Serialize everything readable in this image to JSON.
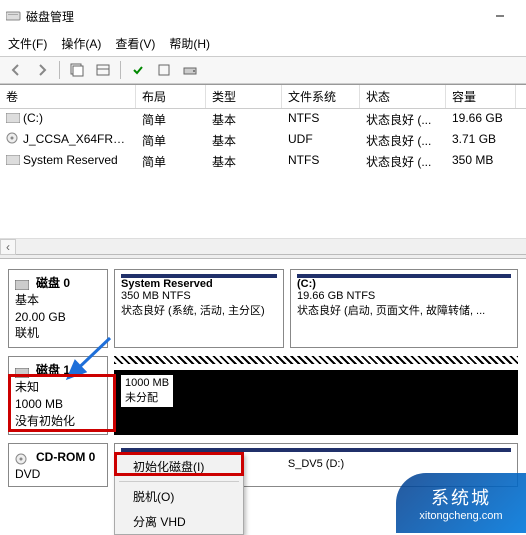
{
  "window": {
    "title": "磁盘管理"
  },
  "menu": {
    "file": "文件(F)",
    "action": "操作(A)",
    "view": "查看(V)",
    "help": "帮助(H)"
  },
  "columns": {
    "volume": "卷",
    "layout": "布局",
    "type": "类型",
    "fs": "文件系统",
    "status": "状态",
    "capacity": "容量"
  },
  "volumes": [
    {
      "name": "(C:)",
      "layout": "简单",
      "type": "基本",
      "fs": "NTFS",
      "status": "状态良好 (...",
      "capacity": "19.66 GB",
      "icon": "vol"
    },
    {
      "name": "J_CCSA_X64FRE_...",
      "layout": "简单",
      "type": "基本",
      "fs": "UDF",
      "status": "状态良好 (...",
      "capacity": "3.71 GB",
      "icon": "cd"
    },
    {
      "name": "System Reserved",
      "layout": "简单",
      "type": "基本",
      "fs": "NTFS",
      "status": "状态良好 (...",
      "capacity": "350 MB",
      "icon": "vol"
    }
  ],
  "disks": {
    "d0": {
      "title": "磁盘 0",
      "type": "基本",
      "size": "20.00 GB",
      "state": "联机",
      "p1": {
        "name": "System Reserved",
        "detail": "350 MB NTFS",
        "status": "状态良好 (系统, 活动, 主分区)"
      },
      "p2": {
        "name": "(C:)",
        "detail": "19.66 GB NTFS",
        "status": "状态良好 (启动, 页面文件, 故障转储, ..."
      }
    },
    "d1": {
      "title": "磁盘 1",
      "type": "未知",
      "size": "1000 MB",
      "state": "没有初始化",
      "unalloc_size": "1000 MB",
      "unalloc_label": "未分配"
    },
    "cd": {
      "title": "CD-ROM 0",
      "type": "DVD",
      "part_label": "S_DV5 (D:)"
    }
  },
  "context_menu": {
    "init": "初始化磁盘(I)",
    "offline": "脱机(O)",
    "detach": "分离 VHD"
  },
  "watermark": {
    "line1": "系统城",
    "line2": "xitongcheng.com"
  }
}
